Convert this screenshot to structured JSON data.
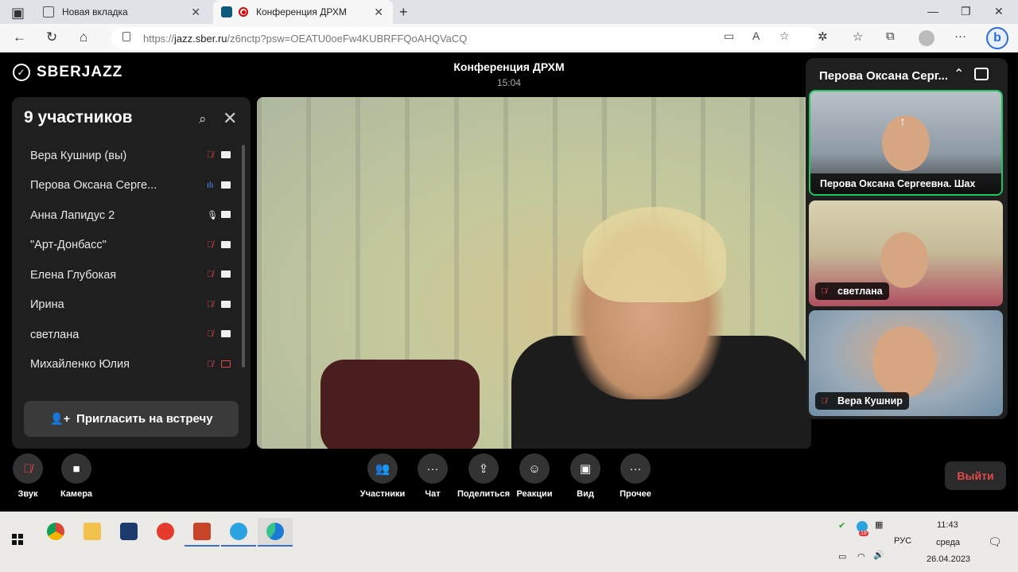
{
  "browser": {
    "tabs": [
      {
        "label": "Новая вкладка"
      },
      {
        "label": "Конференция ДРХМ"
      }
    ],
    "url_prefix": "https://",
    "url_domain": "jazz.sber.ru",
    "url_path": "/z6nctp?psw=OEATU0oeFw4KUBRFFQoAHQVaCQ"
  },
  "app": {
    "logo": "SBERJAZZ",
    "title": "Конференция ДРХМ",
    "elapsed": "15:04"
  },
  "participants_panel": {
    "title": "9 участников",
    "items": [
      {
        "name": "Вера Кушнир (вы)",
        "mic": "muted",
        "cam": "on"
      },
      {
        "name": "Перова Оксана Серге...",
        "mic": "speaking",
        "cam": "on"
      },
      {
        "name": "Анна Лапидус 2",
        "mic": "on",
        "cam": "on"
      },
      {
        "name": "\"Арт-Донбасс\"",
        "mic": "muted",
        "cam": "on"
      },
      {
        "name": "Елена Глубокая",
        "mic": "muted",
        "cam": "on"
      },
      {
        "name": "Ирина",
        "mic": "muted",
        "cam": "on"
      },
      {
        "name": "светлана",
        "mic": "muted",
        "cam": "on"
      },
      {
        "name": "Михайленко Юлия",
        "mic": "muted",
        "cam": "off"
      }
    ],
    "invite_label": "Пригласить на встречу"
  },
  "side_panel": {
    "title": "Перова Оксана Серг...",
    "tiles": [
      {
        "name": "Перова Оксана Сергеевна. Шах"
      },
      {
        "name": "светлана"
      },
      {
        "name": "Вера Кушнир"
      }
    ]
  },
  "controls": {
    "sound": "Звук",
    "camera": "Камера",
    "participants": "Участники",
    "chat": "Чат",
    "share": "Поделиться",
    "reactions": "Реакции",
    "view": "Вид",
    "more": "Прочее",
    "leave": "Выйти"
  },
  "taskbar": {
    "lang": "РУС",
    "time": "11:43",
    "day": "среда",
    "date": "26.04.2023",
    "badge": "19"
  }
}
